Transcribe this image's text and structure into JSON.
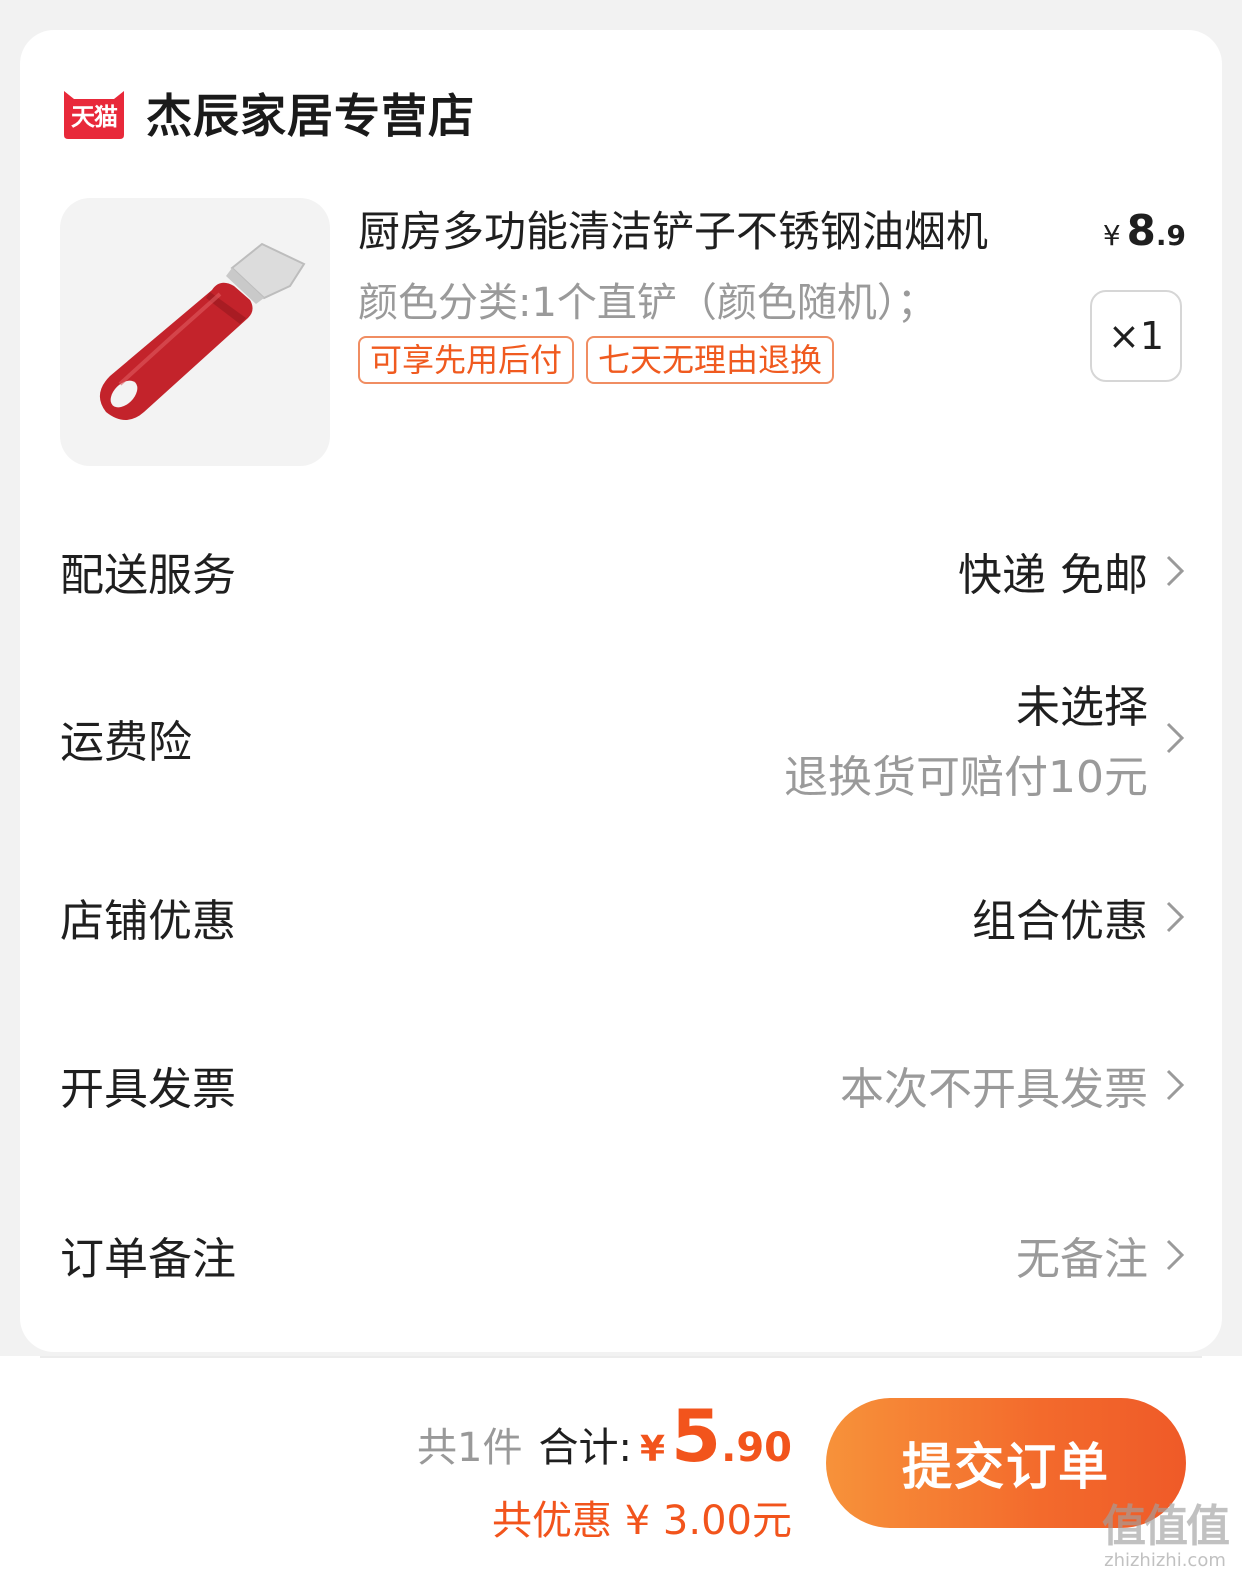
{
  "shop": {
    "logo_text": "天猫",
    "name": "杰辰家居专营店"
  },
  "product": {
    "image_icon": "red-handle-scraper",
    "title": "厨房多功能清洁铲子不锈钢油烟机",
    "price_symbol": "¥",
    "price_int": "8",
    "price_dec": ".9",
    "spec": "颜色分类:1个直铲（颜色随机）；",
    "tags": [
      "可享先用后付",
      "七天无理由退换"
    ],
    "quantity": "×1"
  },
  "rows": {
    "delivery": {
      "label": "配送服务",
      "value": "快递 免邮"
    },
    "insurance": {
      "label": "运费险",
      "value": "未选择",
      "sub": "退换货可赔付10元"
    },
    "discount": {
      "label": "店铺优惠",
      "value": "组合优惠"
    },
    "invoice": {
      "label": "开具发票",
      "value": "本次不开具发票"
    },
    "remark": {
      "label": "订单备注",
      "value": "无备注"
    }
  },
  "footer": {
    "count": "共1件",
    "total_label": "合计:",
    "currency": "¥",
    "total_int": "5",
    "total_dec": ".90",
    "saved": "共优惠 ¥ 3.00元",
    "submit": "提交订单"
  },
  "watermark": {
    "mark": "值值值",
    "site": "zhizhizhi.com"
  },
  "colors": {
    "accent": "#f2541c",
    "tag_border": "#f08d62",
    "tmall_red": "#e8293a"
  }
}
